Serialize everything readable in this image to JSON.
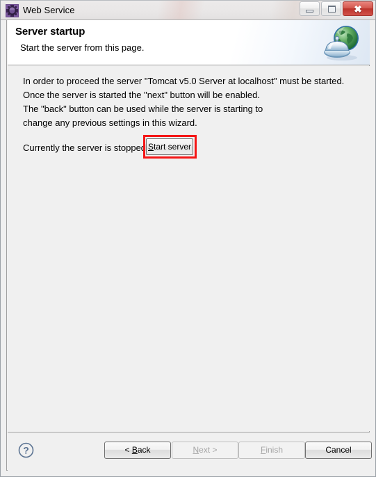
{
  "window": {
    "title": "Web Service",
    "icon": "web-service-gear-icon",
    "controls": {
      "minimize": "minimize-icon",
      "restore": "restore-icon",
      "close": "close-icon",
      "close_glyph": "✖",
      "close_color": "#c0392b"
    }
  },
  "header": {
    "title": "Server startup",
    "subtitle": "Start the server from this page.",
    "icon": "globe-server-icon"
  },
  "content": {
    "lines": [
      "In order to proceed the server \"Tomcat v5.0 Server at localhost\" must be started.",
      "Once the server is started the \"next\" button will be enabled.",
      "The \"back\" button can be used while the server is starting to",
      "change any previous settings in this wizard."
    ],
    "status_label": "Currently the server is stopped.",
    "start_button": {
      "mnemonic": "S",
      "rest": "tart server",
      "label": "Start server",
      "highlighted": true,
      "highlight_color": "#f51616"
    }
  },
  "footer": {
    "help_icon": "help-question-icon",
    "buttons": [
      {
        "name": "back",
        "prefix": "< ",
        "mnemonic": "B",
        "suffix": "ack",
        "label": "< Back",
        "enabled": true
      },
      {
        "name": "next",
        "prefix": "",
        "mnemonic": "N",
        "suffix": "ext >",
        "label": "Next >",
        "enabled": false
      },
      {
        "name": "finish",
        "prefix": "",
        "mnemonic": "F",
        "suffix": "inish",
        "label": "Finish",
        "enabled": false
      },
      {
        "name": "cancel",
        "prefix": "",
        "mnemonic": "",
        "suffix": "Cancel",
        "label": "Cancel",
        "enabled": true
      }
    ]
  }
}
